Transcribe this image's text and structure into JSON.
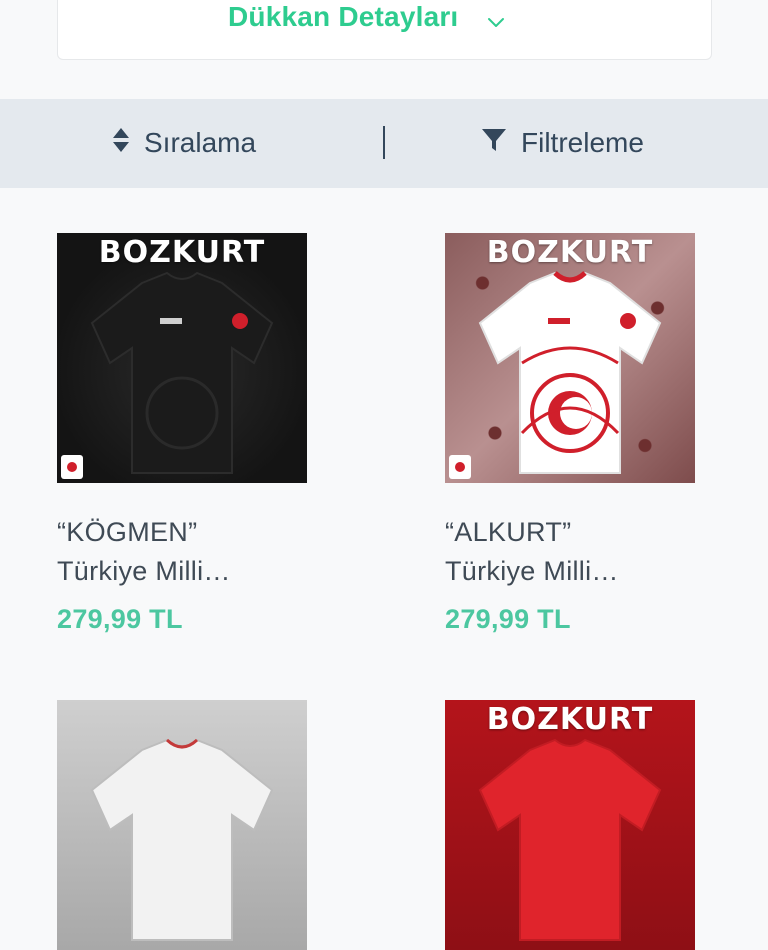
{
  "shop_details": {
    "label": "Dükkan Detayları",
    "icon": "chevron-down-icon"
  },
  "toolbar": {
    "sort_label": "Sıralama",
    "sort_icon": "sort-icon",
    "filter_label": "Filtreleme",
    "filter_icon": "filter-icon"
  },
  "colors": {
    "accent": "#2ecc8f",
    "price": "#4cc7a0",
    "bar_bg": "#e4e9ee",
    "text_dark": "#33475b"
  },
  "products": [
    {
      "brand": "BOZKURT",
      "name_line1": "“KÖGMEN”",
      "name_line2": "Türkiye Milli…",
      "price": "279,99 TL",
      "jersey_color": "#1b1b1b"
    },
    {
      "brand": "BOZKURT",
      "name_line1": "“ALKURT”",
      "name_line2": "Türkiye Milli…",
      "price": "279,99 TL",
      "jersey_color": "#ffffff"
    },
    {
      "brand": "",
      "name_line1": "",
      "name_line2": "",
      "price": "",
      "jersey_color": "#ffffff"
    },
    {
      "brand": "BOZKURT",
      "name_line1": "",
      "name_line2": "",
      "price": "",
      "jersey_color": "#e0242c"
    }
  ]
}
